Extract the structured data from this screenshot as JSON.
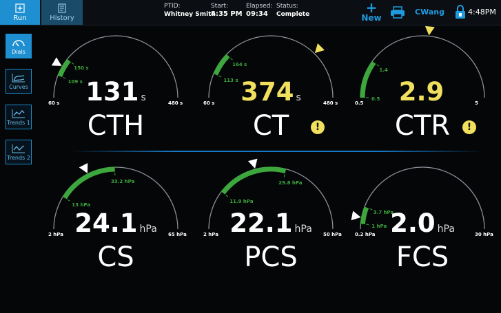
{
  "tabs": {
    "run": "Run",
    "history": "History"
  },
  "status": {
    "ptid_label": "PTID:",
    "ptid_value": "Whitney Smith",
    "start_label": "Start:",
    "start_value": "4:35 PM",
    "elapsed_label": "Elapsed:",
    "elapsed_value": "09:34",
    "status_label": "Status:",
    "status_value": "Complete"
  },
  "toolbar": {
    "new_label": "New",
    "user": "CWang",
    "time": "4:48PM"
  },
  "sidebar": [
    {
      "label": "Dials",
      "icon": "dial-icon",
      "active": true
    },
    {
      "label": "Curves",
      "icon": "curve-icon",
      "active": false
    },
    {
      "label": "Trends 1",
      "icon": "trend-icon",
      "active": false
    },
    {
      "label": "Trends 2",
      "icon": "trend-icon",
      "active": false
    }
  ],
  "colors": {
    "accent": "#1e8fd0",
    "green": "#3ca73c",
    "warning": "#f1df5e"
  },
  "gauges": [
    {
      "name": "CTH",
      "value": "131",
      "unit": "s",
      "min": 60,
      "max": 480,
      "min_label": "60 s",
      "max_label": "480 s",
      "range_low": 109,
      "range_high": 150,
      "low_label": "109 s",
      "high_label": "150 s",
      "marker": 131,
      "value_color": "#ffffff",
      "warning": false
    },
    {
      "name": "CT",
      "value": "374",
      "unit": "s",
      "min": 60,
      "max": 480,
      "min_label": "60 s",
      "max_label": "480 s",
      "range_low": 113,
      "range_high": 164,
      "low_label": "113 s",
      "high_label": "164 s",
      "marker": 374,
      "value_color": "#f1df5e",
      "warning": true
    },
    {
      "name": "CTR",
      "value": "2.9",
      "unit": "",
      "min": 0.5,
      "max": 5,
      "min_label": "0.5",
      "max_label": "5",
      "range_low": 0.5,
      "range_high": 1.4,
      "low_label": "0.5",
      "high_label": "1.4",
      "marker": 2.9,
      "value_color": "#f1df5e",
      "warning": true
    },
    {
      "name": "CS",
      "value": "24.1",
      "unit": "hPa",
      "min": 2,
      "max": 65,
      "min_label": "2 hPa",
      "max_label": "65 hPa",
      "range_low": 13,
      "range_high": 33.2,
      "low_label": "13 hPa",
      "high_label": "33.2 hPa",
      "marker": 24.1,
      "value_color": "#ffffff",
      "warning": false
    },
    {
      "name": "PCS",
      "value": "22.1",
      "unit": "hPa",
      "min": 2,
      "max": 50,
      "min_label": "2 hPa",
      "max_label": "50 hPa",
      "range_low": 11.9,
      "range_high": 29.8,
      "low_label": "11.9 hPa",
      "high_label": "29.8 hPa",
      "marker": 22.1,
      "value_color": "#ffffff",
      "warning": false
    },
    {
      "name": "FCS",
      "value": "2.0",
      "unit": "hPa",
      "min": 0.2,
      "max": 30,
      "min_label": "0.2 hPa",
      "max_label": "30 hPa",
      "range_low": 1,
      "range_high": 3.7,
      "low_label": "1 hPa",
      "high_label": "3.7 hPa",
      "marker": 2,
      "value_color": "#ffffff",
      "warning": false
    }
  ]
}
